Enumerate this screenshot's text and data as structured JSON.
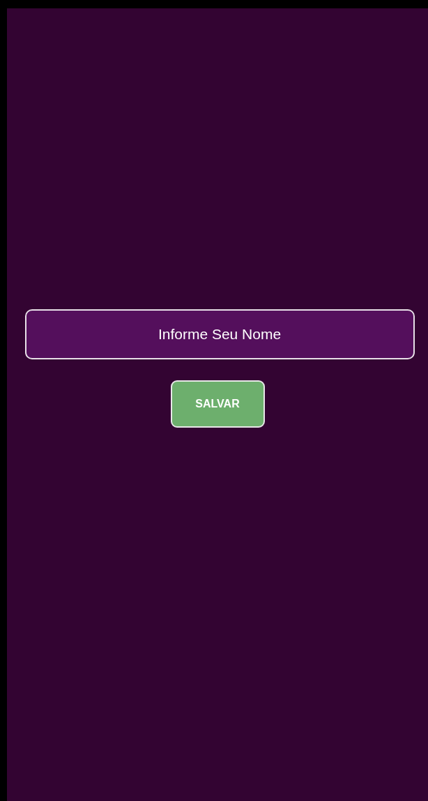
{
  "name_field": {
    "placeholder": "Informe Seu Nome"
  },
  "save_button": {
    "label": "SALVAR"
  }
}
